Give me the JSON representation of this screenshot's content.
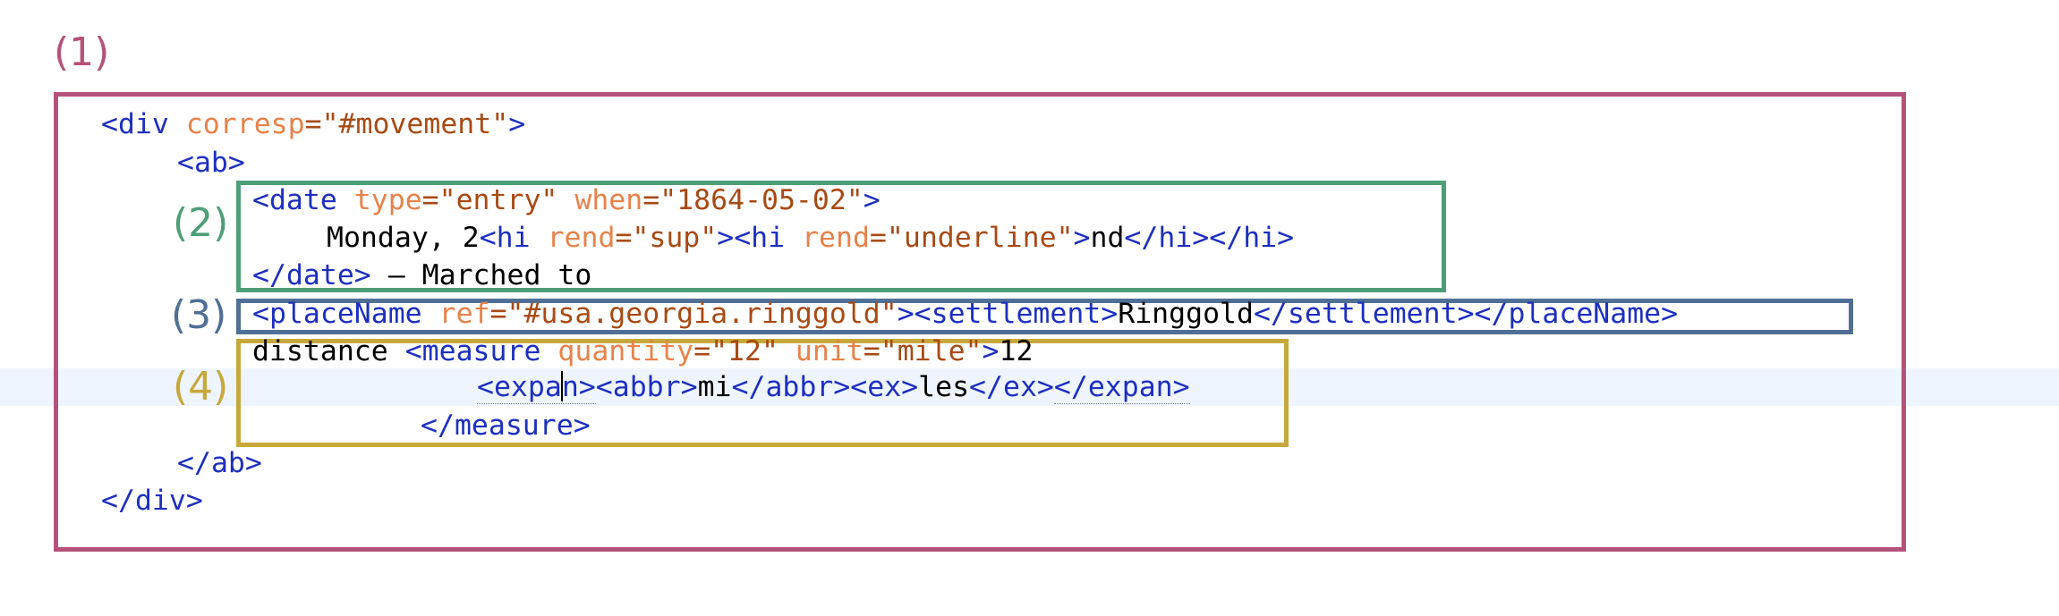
{
  "callouts": [
    {
      "label": "(1)",
      "color": "#b5527a"
    },
    {
      "label": "(2)",
      "color": "#4e9f78"
    },
    {
      "label": "(3)",
      "color": "#4f6f96"
    },
    {
      "label": "(4)",
      "color": "#c7a83a"
    }
  ],
  "colors": {
    "tag": "#1d2fbf",
    "attr_name": "#e8824a",
    "attr_value": "#a84a14",
    "text": "#000000",
    "current_line": "#eef5ff"
  },
  "code": {
    "l1": {
      "open": "<",
      "name": "div",
      "attr": "corresp",
      "eq": "=",
      "val": "\"#movement\"",
      "close": ">"
    },
    "l2": {
      "open": "<",
      "name": "ab",
      "close": ">"
    },
    "l3": {
      "open": "<",
      "name": "date",
      "attr1": "type",
      "eq": "=",
      "val1": "\"entry\"",
      "attr2": "when",
      "val2": "\"1864-05-02\"",
      "close": ">"
    },
    "l4": {
      "text1": "Monday, 2",
      "open": "<",
      "hi": "hi",
      "rend": "rend",
      "eq": "=",
      "sup": "\"sup\"",
      "close": ">",
      "underline": "\"underline\"",
      "text2": "nd",
      "endopen": "</"
    },
    "l5": {
      "endopen": "</",
      "name": "date",
      "close": ">",
      "text": " – Marched to"
    },
    "l6": {
      "open": "<",
      "name": "placeName",
      "attr": "ref",
      "eq": "=",
      "val": "\"#usa.georgia.ringgold\"",
      "close": ">",
      "settlement": "settlement",
      "text": "Ringgold",
      "endopen": "</"
    },
    "l7": {
      "text1": "distance ",
      "open": "<",
      "name": "measure",
      "attr1": "quantity",
      "eq": "=",
      "val1": "\"12\"",
      "attr2": "unit",
      "val2": "\"mile\"",
      "close": ">",
      "text2": "12"
    },
    "l8": {
      "open": "<",
      "expan_a": "expa",
      "expan_b": "n",
      "close": ">",
      "abbr": "abbr",
      "abbr_text": "mi",
      "ex": "ex",
      "ex_text": "les",
      "endopen": "</",
      "expan": "expan"
    },
    "l9": {
      "endopen": "</",
      "name": "measure",
      "close": ">"
    },
    "l10": {
      "endopen": "</",
      "name": "ab",
      "close": ">"
    },
    "l11": {
      "endopen": "</",
      "name": "div",
      "close": ">"
    }
  }
}
